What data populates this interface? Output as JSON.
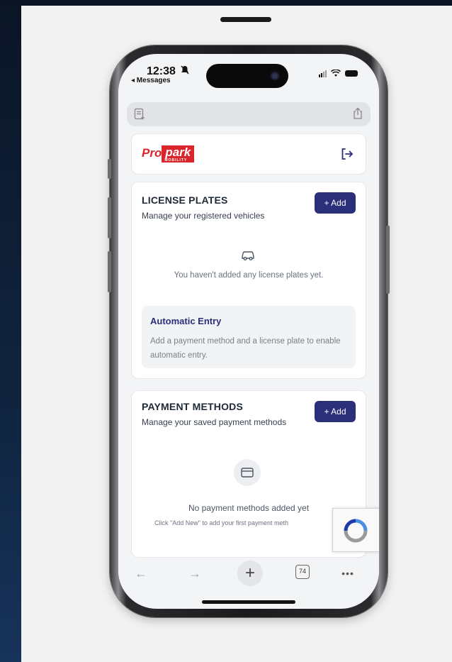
{
  "status_bar": {
    "time": "12:38",
    "back_label": "◂ Messages"
  },
  "header": {
    "logo_pro": "Pro",
    "logo_park": "park",
    "logo_tagline": "MOBILITY"
  },
  "license_plates": {
    "title": "LICENSE PLATES",
    "subtitle": "Manage your registered vehicles",
    "add_label": "+ Add",
    "empty_message": "You haven't added any license plates yet."
  },
  "automatic_entry": {
    "title": "Automatic Entry",
    "description": "Add a payment method and a license plate to enable automatic entry."
  },
  "payment_methods": {
    "title": "PAYMENT METHODS",
    "subtitle": "Manage your saved payment methods",
    "add_label": "+ Add",
    "empty_message": "No payment methods added yet",
    "hint": "Click \"Add New\" to add your first payment meth"
  },
  "toolbar": {
    "tabs_count": "74",
    "icons": [
      "back-arrow-icon",
      "forward-arrow-icon",
      "plus-icon",
      "tabs-icon",
      "more-icon"
    ]
  },
  "colors": {
    "brand_red": "#d9262c",
    "primary_button": "#2b2f7a"
  }
}
